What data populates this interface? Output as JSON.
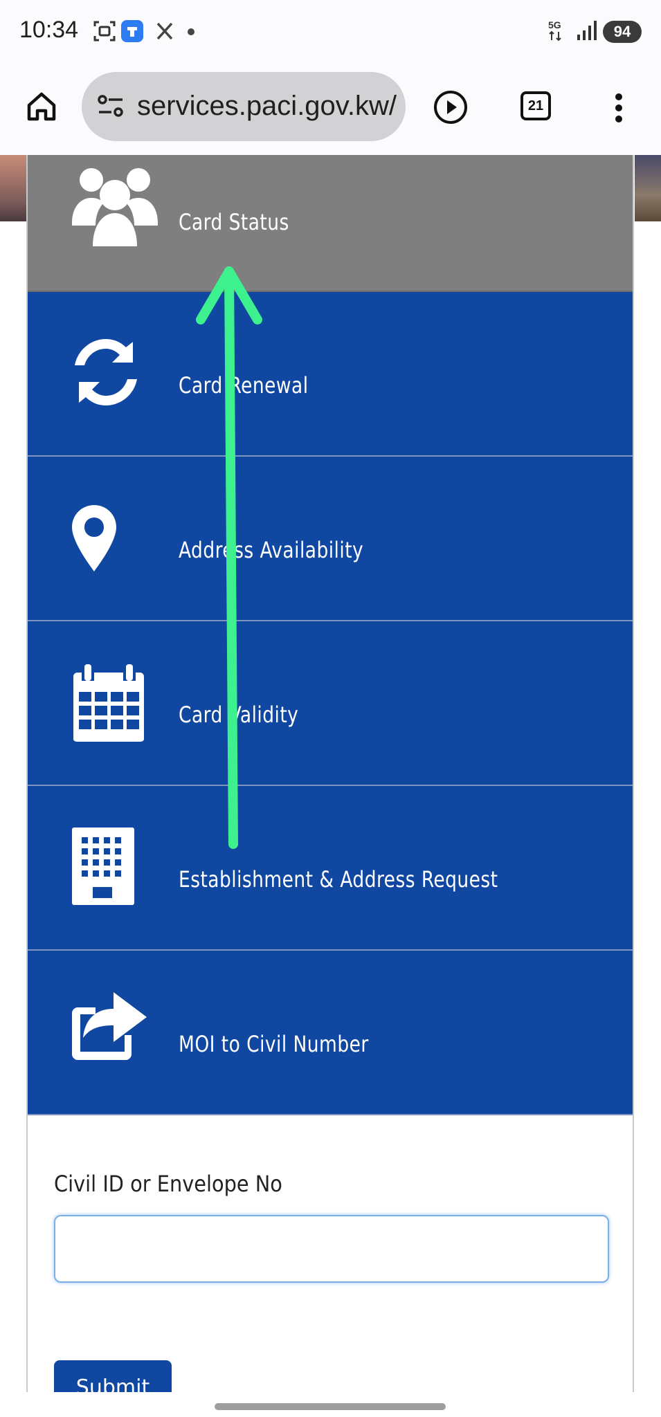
{
  "status_bar": {
    "time": "10:34",
    "left_icons": [
      "screenshot-icon",
      "app-notification-icon",
      "x-icon",
      "dot-icon"
    ],
    "network": "5G",
    "battery": "94"
  },
  "browser": {
    "url": "services.paci.gov.kw/",
    "tab_count": "21",
    "icons": [
      "home-icon",
      "site-settings-icon",
      "play-icon",
      "tabs-icon",
      "menu-icon"
    ]
  },
  "services": [
    {
      "label": "Card Status",
      "icon": "users-icon",
      "active": true
    },
    {
      "label": "Card Renewal",
      "icon": "refresh-icon",
      "active": false
    },
    {
      "label": "Address Availability",
      "icon": "map-marker-icon",
      "active": false
    },
    {
      "label": "Card Validity",
      "icon": "calendar-icon",
      "active": false
    },
    {
      "label": "Establishment & Address Request",
      "icon": "building-icon",
      "active": false
    },
    {
      "label": "MOI to Civil Number",
      "icon": "share-icon",
      "active": false
    }
  ],
  "form": {
    "label": "Civil ID or Envelope No",
    "input_value": "",
    "submit_label": "Submit"
  },
  "colors": {
    "service_blue": "#0f47a1",
    "service_active_gray": "#7f7f7f",
    "swipe_arrow_green": "#3df28e"
  }
}
